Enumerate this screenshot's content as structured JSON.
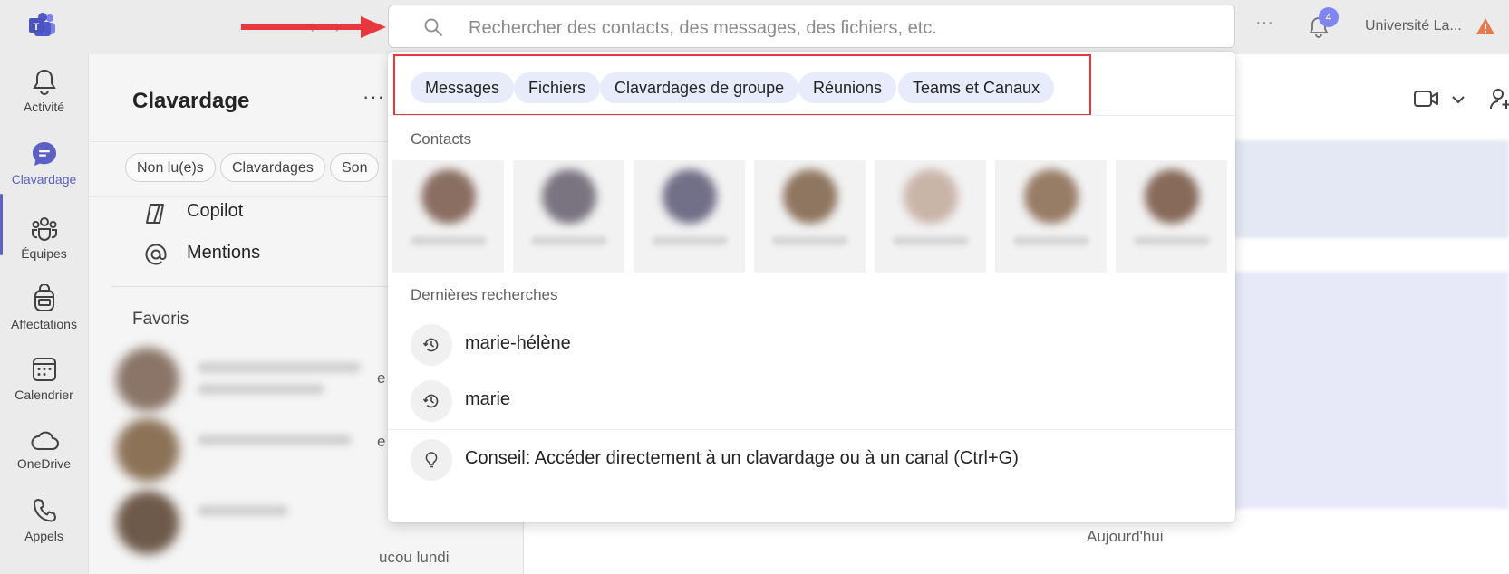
{
  "topbar": {
    "org_name": "Université La...",
    "notification_count": "4"
  },
  "rail": {
    "items": [
      {
        "label": "Activité",
        "icon": "bell-icon"
      },
      {
        "label": "Clavardage",
        "icon": "chat-icon",
        "active": true
      },
      {
        "label": "Équipes",
        "icon": "teams-icon"
      },
      {
        "label": "Affectations",
        "icon": "backpack-icon"
      },
      {
        "label": "Calendrier",
        "icon": "calendar-icon"
      },
      {
        "label": "OneDrive",
        "icon": "cloud-icon"
      },
      {
        "label": "Appels",
        "icon": "phone-icon"
      }
    ]
  },
  "chat": {
    "title": "Clavardage",
    "filters": [
      "Non lu(e)s",
      "Clavardages",
      "Son"
    ],
    "copilot": "Copilot",
    "mentions": "Mentions",
    "favorites_title": "Favoris",
    "partial_e": "e",
    "partial_coucou": "ucou lundi"
  },
  "search": {
    "placeholder": "Rechercher des contacts, des messages, des fichiers, etc.",
    "value": "",
    "scopes": [
      "Messages",
      "Fichiers",
      "Clavardages de groupe",
      "Réunions",
      "Teams et Canaux"
    ],
    "contacts_title": "Contacts",
    "recent_title": "Dernières recherches",
    "recent": [
      "marie-hélène",
      "marie"
    ],
    "tip": "Conseil: Accéder directement à un clavardage ou à un canal (Ctrl+G)"
  },
  "conversation": {
    "today_label": "Aujourd'hui"
  },
  "colors": {
    "accent": "#5b5fc7",
    "highlight_box": "#e03a3e",
    "pill_bg": "#e8ebfa"
  }
}
